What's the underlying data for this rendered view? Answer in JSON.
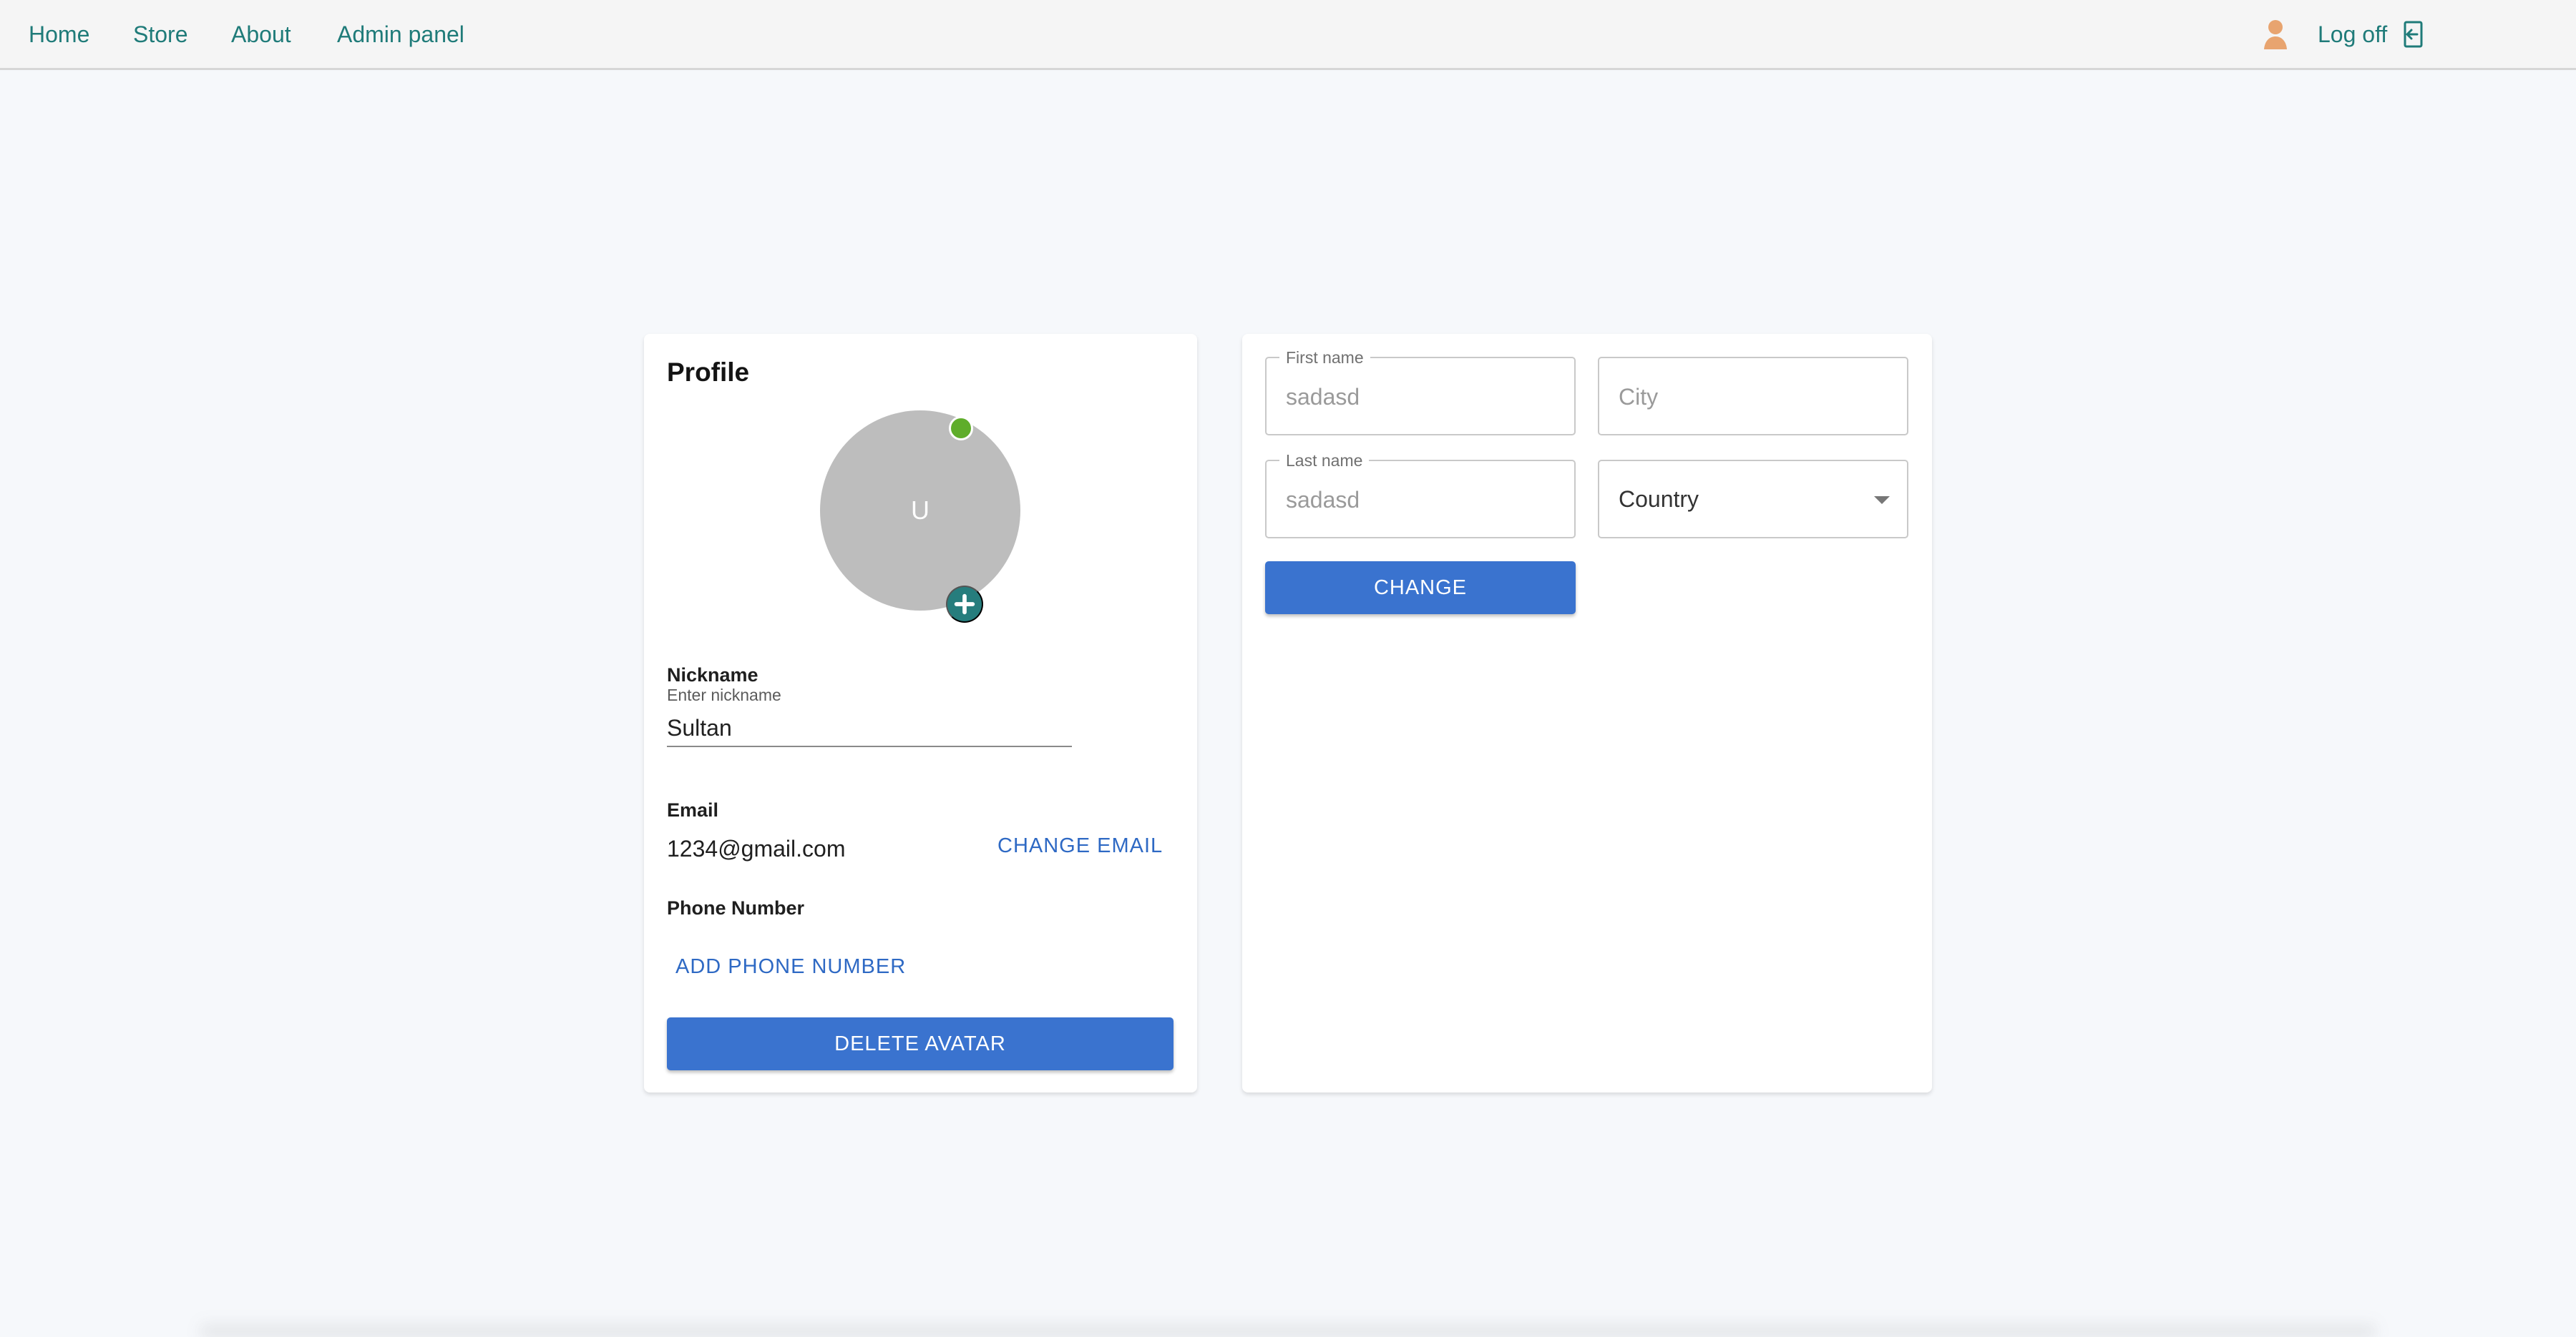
{
  "nav": {
    "items": [
      {
        "label": "Home"
      },
      {
        "label": "Store"
      },
      {
        "label": "About"
      },
      {
        "label": "Admin panel"
      }
    ],
    "logoff_label": "Log off"
  },
  "profile": {
    "title": "Profile",
    "avatar_initial": "U",
    "online_status_color": "#5fad2b",
    "nickname_label": "Nickname",
    "nickname_hint": "Enter nickname",
    "nickname_value": "Sultan",
    "email_label": "Email",
    "email_value": "1234@gmail.com",
    "change_email_label": "CHANGE EMAIL",
    "phone_label": "Phone Number",
    "add_phone_label": "ADD PHONE NUMBER",
    "delete_avatar_label": "DELETE AVATAR"
  },
  "details": {
    "first_name_label": "First name",
    "first_name_value": "sadasd",
    "city_placeholder": "City",
    "last_name_label": "Last name",
    "last_name_value": "sadasd",
    "country_selected": "Country",
    "change_label": "CHANGE"
  },
  "icons": {
    "user": "user-icon",
    "logoff": "logoff-icon",
    "online": "online-status-icon",
    "add_avatar": "plus-icon",
    "dropdown": "chevron-down-icon"
  },
  "colors": {
    "nav_text": "#1f7b79",
    "user_icon": "#e8a46f",
    "primary_button": "#3a73cf",
    "text_button": "#2e69c4",
    "avatar_background": "#bdbdbd",
    "add_avatar_button": "#267d7d"
  }
}
